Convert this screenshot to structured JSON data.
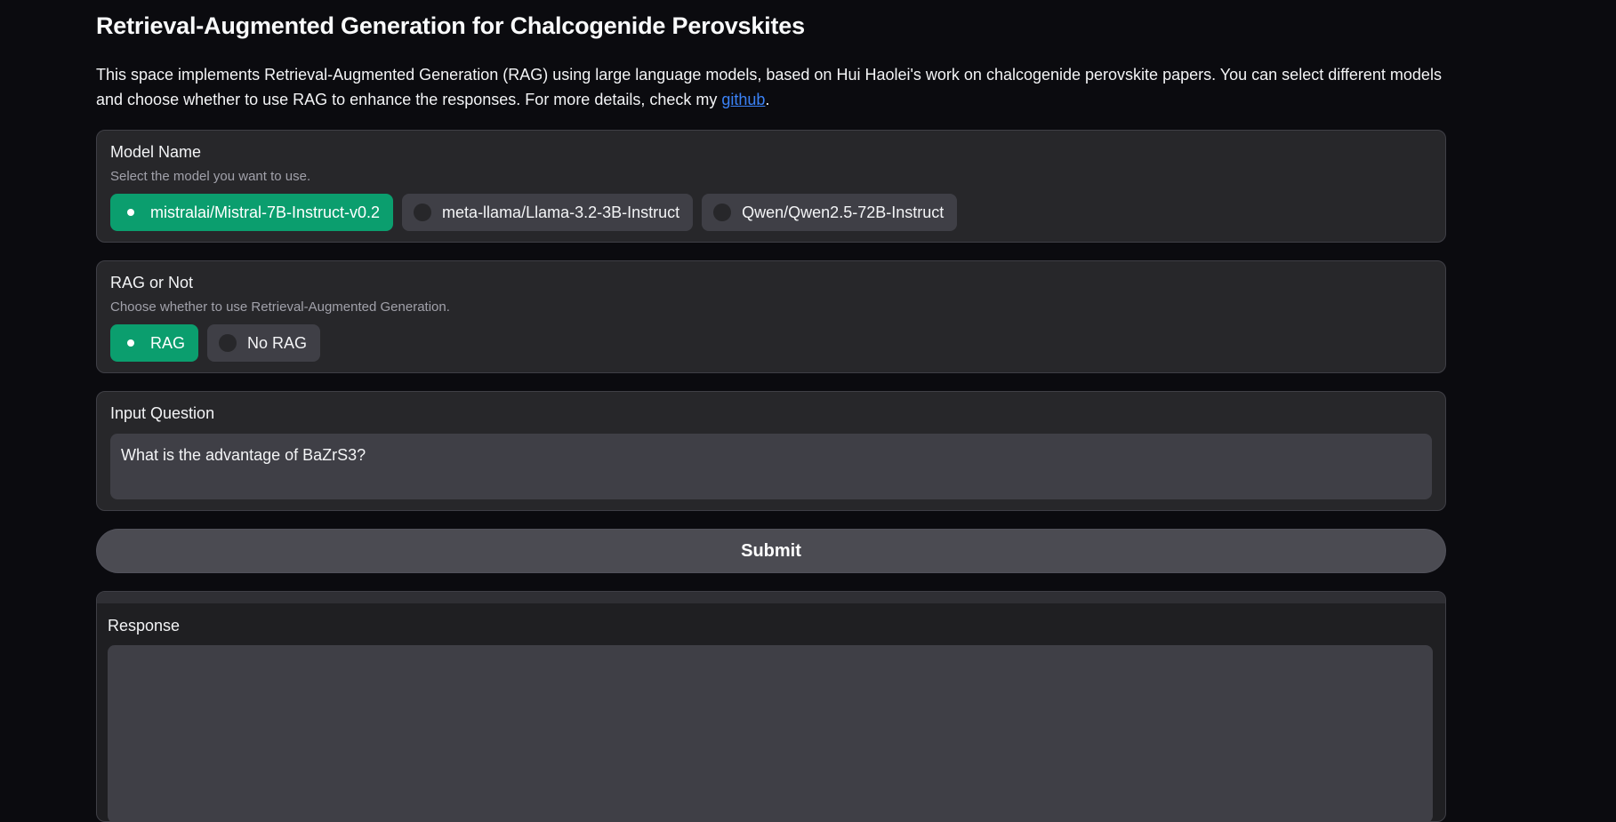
{
  "header": {
    "title": "Retrieval-Augmented Generation for Chalcogenide Perovskites",
    "description": "This space implements Retrieval-Augmented Generation (RAG) using large language models, based on Hui Haolei's work on chalcogenide perovskite papers. You can select different models and choose whether to use RAG to enhance the responses. For more details, check my ",
    "link_text": "github",
    "description_end": "."
  },
  "model_select": {
    "label": "Model Name",
    "info": "Select the model you want to use.",
    "options": [
      {
        "label": "mistralai/Mistral-7B-Instruct-v0.2",
        "selected": true
      },
      {
        "label": "meta-llama/Llama-3.2-3B-Instruct",
        "selected": false
      },
      {
        "label": "Qwen/Qwen2.5-72B-Instruct",
        "selected": false
      }
    ]
  },
  "rag_select": {
    "label": "RAG or Not",
    "info": "Choose whether to use Retrieval-Augmented Generation.",
    "options": [
      {
        "label": "RAG",
        "selected": true
      },
      {
        "label": "No RAG",
        "selected": false
      }
    ]
  },
  "question": {
    "label": "Input Question",
    "value": "What is the advantage of BaZrS3?"
  },
  "submit": {
    "label": "Submit"
  },
  "response": {
    "label": "Response",
    "value": ""
  },
  "colors": {
    "background": "#0b0b0f",
    "panel": "#27272a",
    "selected_accent": "#0b9e6e",
    "link": "#3b82f6"
  }
}
